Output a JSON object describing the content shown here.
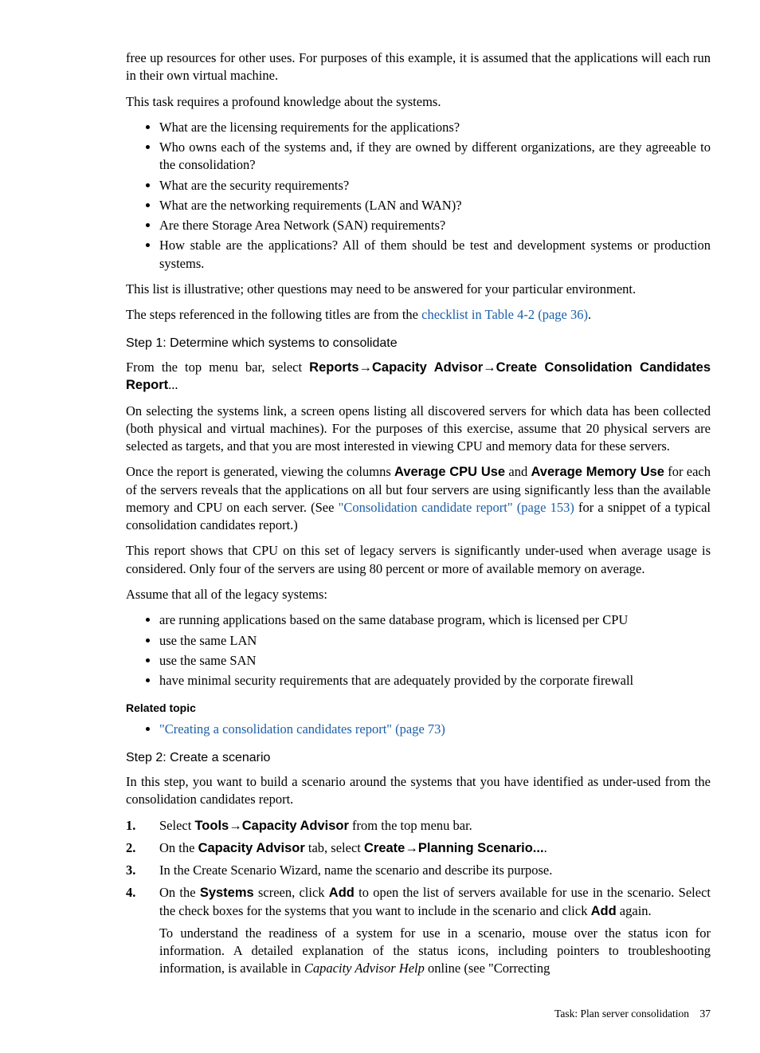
{
  "intro": {
    "p1": "free up resources for other uses. For purposes of this example, it is assumed that the applications will each run in their own virtual machine.",
    "p2": "This task requires a profound knowledge about the systems.",
    "bullets": [
      "What are the licensing requirements for the applications?",
      "Who owns each of the systems and, if they are owned by different organizations, are they agreeable to the consolidation?",
      "What are the security requirements?",
      "What are the networking requirements (LAN and WAN)?",
      "Are there Storage Area Network (SAN) requirements?",
      "How stable are the applications? All of them should be test and development systems or production systems."
    ],
    "p3": "This list is illustrative; other questions may need to be answered for your particular environment.",
    "p4a": "The steps referenced in the following titles are from the ",
    "p4link": "checklist in Table 4-2 (page 36)",
    "p4b": "."
  },
  "step1": {
    "heading": "Step 1: Determine which systems to consolidate",
    "p1a": "From the top menu bar, select ",
    "p1b": "Reports",
    "arrow": "→",
    "p1c": "Capacity Advisor",
    "p1d": "Create Consolidation Candidates Report",
    "p1e": "...",
    "p2": "On selecting the systems link, a screen opens listing all discovered servers for which data has been collected (both physical and virtual machines). For the purposes of this exercise, assume that 20 physical servers are selected as targets, and that you are most interested in viewing CPU and memory data for these servers.",
    "p3a": "Once the report is generated, viewing the columns ",
    "p3b": "Average CPU Use",
    "p3c": " and ",
    "p3d": "Average Memory Use",
    "p3e": " for each of the servers reveals that the applications on all but four servers are using significantly less than the available memory and CPU on each server. (See ",
    "p3link": "\"Consolidation candidate report\" (page 153)",
    "p3f": " for a snippet of a typical consolidation candidates report.)",
    "p4": "This report shows that CPU on this set of legacy servers is significantly under-used when average usage is considered. Only four of the servers are using 80 percent or more of available memory on average.",
    "p5": "Assume that all of the legacy systems:",
    "bullets": [
      "are running applications based on the same database program, which is licensed per CPU",
      "use the same LAN",
      "use the same SAN",
      "have minimal security requirements that are adequately provided by the corporate firewall"
    ],
    "related_heading": "Related topic",
    "related_link": "\"Creating a consolidation candidates report\" (page 73)"
  },
  "step2": {
    "heading": "Step 2: Create a scenario",
    "p1": "In this step, you want to build a scenario around the systems that you have identified as under-used from the consolidation candidates report.",
    "s1a": "Select ",
    "s1b": "Tools",
    "s1c": "Capacity Advisor",
    "s1d": " from the top menu bar.",
    "s2a": "On the ",
    "s2b": "Capacity Advisor",
    "s2c": " tab, select ",
    "s2d": "Create",
    "s2e": "Planning Scenario...",
    "s2f": ".",
    "s3": "In the Create Scenario Wizard, name the scenario and describe its purpose.",
    "s4a": "On the ",
    "s4b": "Systems",
    "s4c": " screen, click ",
    "s4d": "Add",
    "s4e": " to open the list of servers available for use in the scenario. Select the check boxes for the systems that you want to include in the scenario and click ",
    "s4f": "Add",
    "s4g": " again.",
    "s4sub_a": "To understand the readiness of a system for use in a scenario, mouse over the status icon for information. A detailed explanation of the status icons, including pointers to troubleshooting information, is available in ",
    "s4sub_i": "Capacity Advisor Help",
    "s4sub_b": " online (see \"Correcting"
  },
  "footer": {
    "label": "Task: Plan server consolidation",
    "pageno": "37"
  }
}
